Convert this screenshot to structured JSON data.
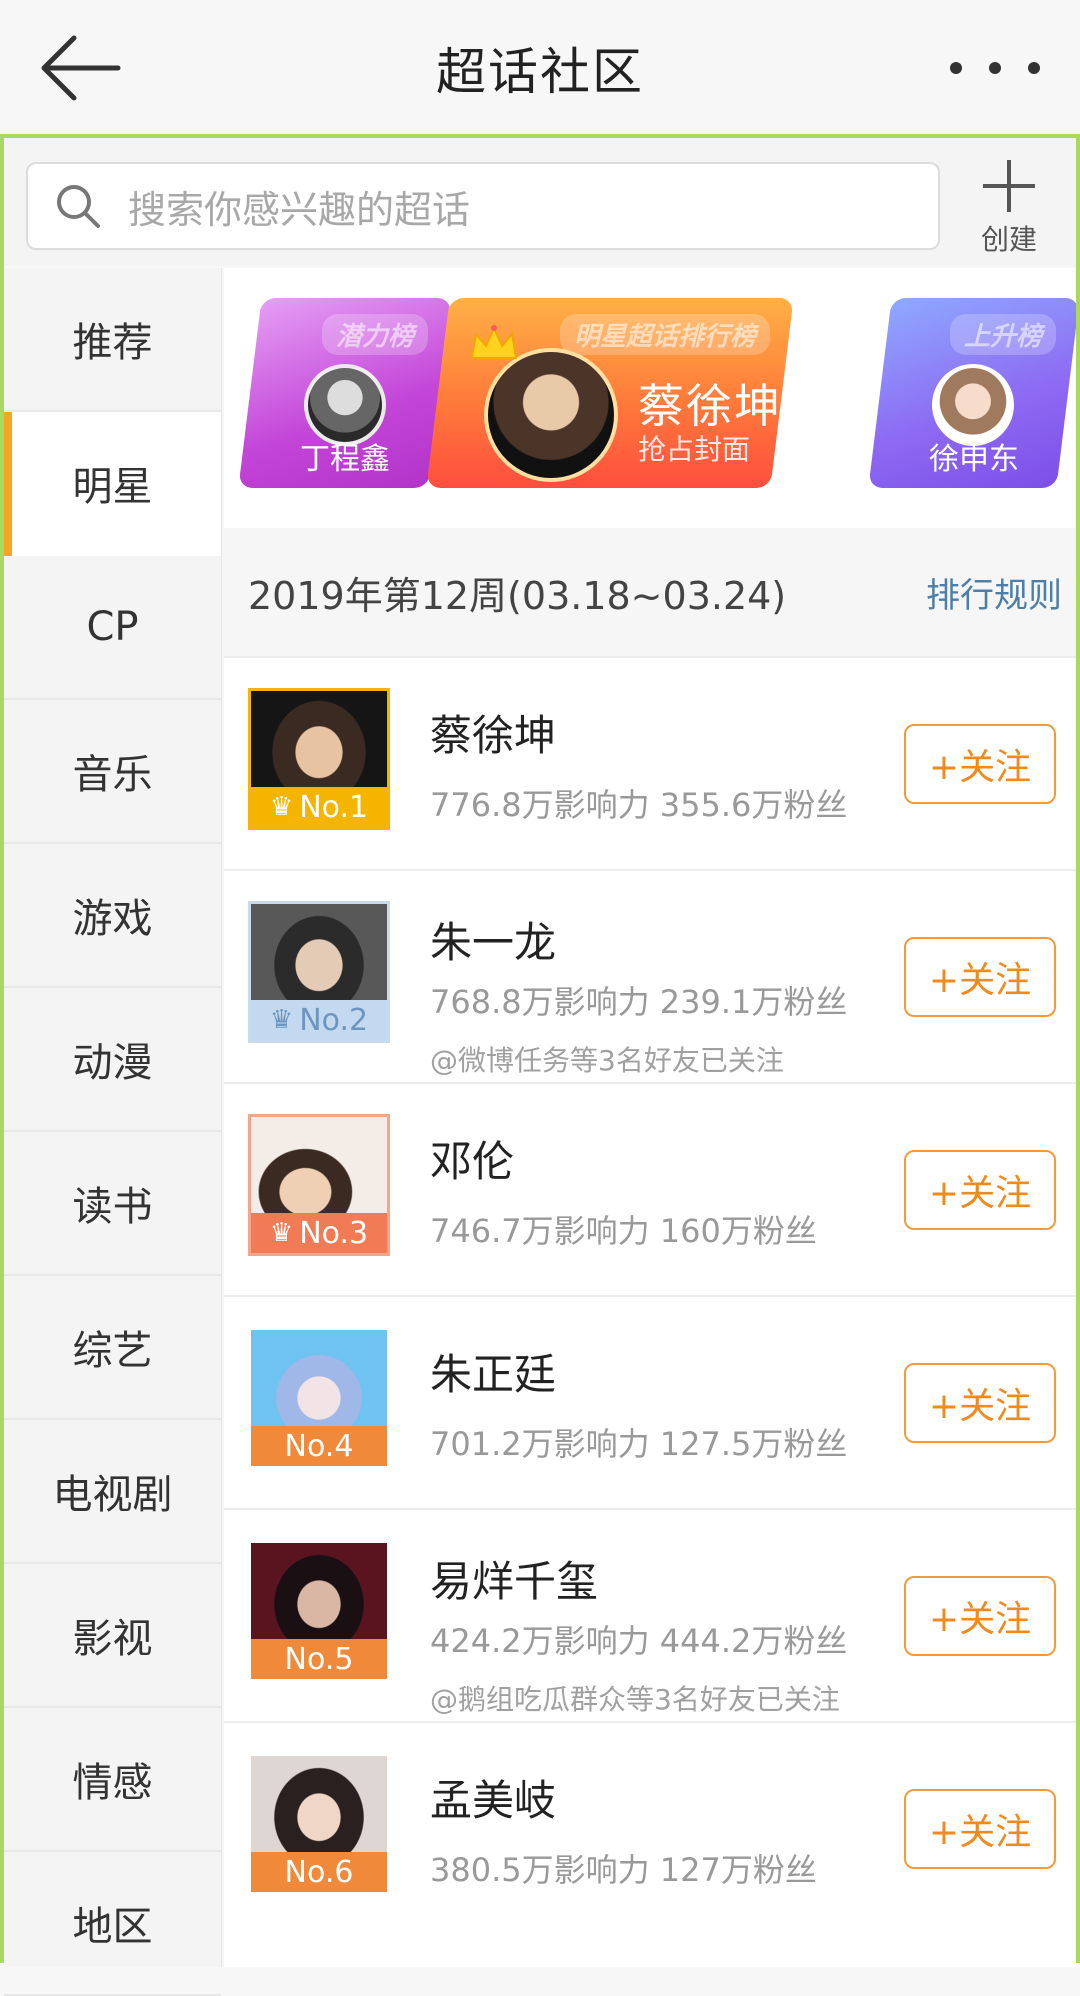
{
  "header": {
    "title": "超话社区"
  },
  "search": {
    "placeholder": "搜索你感兴趣的超话",
    "create_label": "创建"
  },
  "sidebar": {
    "items": [
      {
        "label": "推荐",
        "active": false
      },
      {
        "label": "明星",
        "active": true
      },
      {
        "label": "CP",
        "active": false
      },
      {
        "label": "音乐",
        "active": false
      },
      {
        "label": "游戏",
        "active": false
      },
      {
        "label": "动漫",
        "active": false
      },
      {
        "label": "读书",
        "active": false
      },
      {
        "label": "综艺",
        "active": false
      },
      {
        "label": "电视剧",
        "active": false
      },
      {
        "label": "影视",
        "active": false
      },
      {
        "label": "情感",
        "active": false
      },
      {
        "label": "地区",
        "active": false
      }
    ]
  },
  "banner": {
    "left": {
      "tag": "潜力榜",
      "name": "丁程鑫"
    },
    "center": {
      "tag": "明星超话排行榜",
      "name": "蔡徐坤",
      "subtitle": "抢占封面"
    },
    "right": {
      "tag": "上升榜",
      "name": "徐申东"
    }
  },
  "ranking": {
    "week": "2019年第12周(03.18~03.24)",
    "rules_label": "排行规则",
    "follow_label": "+关注",
    "items": [
      {
        "rank": "No.1",
        "name": "蔡徐坤",
        "stats": "776.8万影响力 355.6万粉丝",
        "friends": "",
        "badge_color": "#f5b400"
      },
      {
        "rank": "No.2",
        "name": "朱一龙",
        "stats": "768.8万影响力 239.1万粉丝",
        "friends": "@微博任务等3名好友已关注",
        "badge_color": "#9fc3e6"
      },
      {
        "rank": "No.3",
        "name": "邓伦",
        "stats": "746.7万影响力 160万粉丝",
        "friends": "",
        "badge_color": "#f07b55"
      },
      {
        "rank": "No.4",
        "name": "朱正廷",
        "stats": "701.2万影响力 127.5万粉丝",
        "friends": "",
        "badge_color": "#f08a3a"
      },
      {
        "rank": "No.5",
        "name": "易烊千玺",
        "stats": "424.2万影响力 444.2万粉丝",
        "friends": "@鹅组吃瓜群众等3名好友已关注",
        "badge_color": "#f08a3a"
      },
      {
        "rank": "No.6",
        "name": "孟美岐",
        "stats": "380.5万影响力 127万粉丝",
        "friends": "",
        "badge_color": "#f08a3a"
      }
    ]
  }
}
